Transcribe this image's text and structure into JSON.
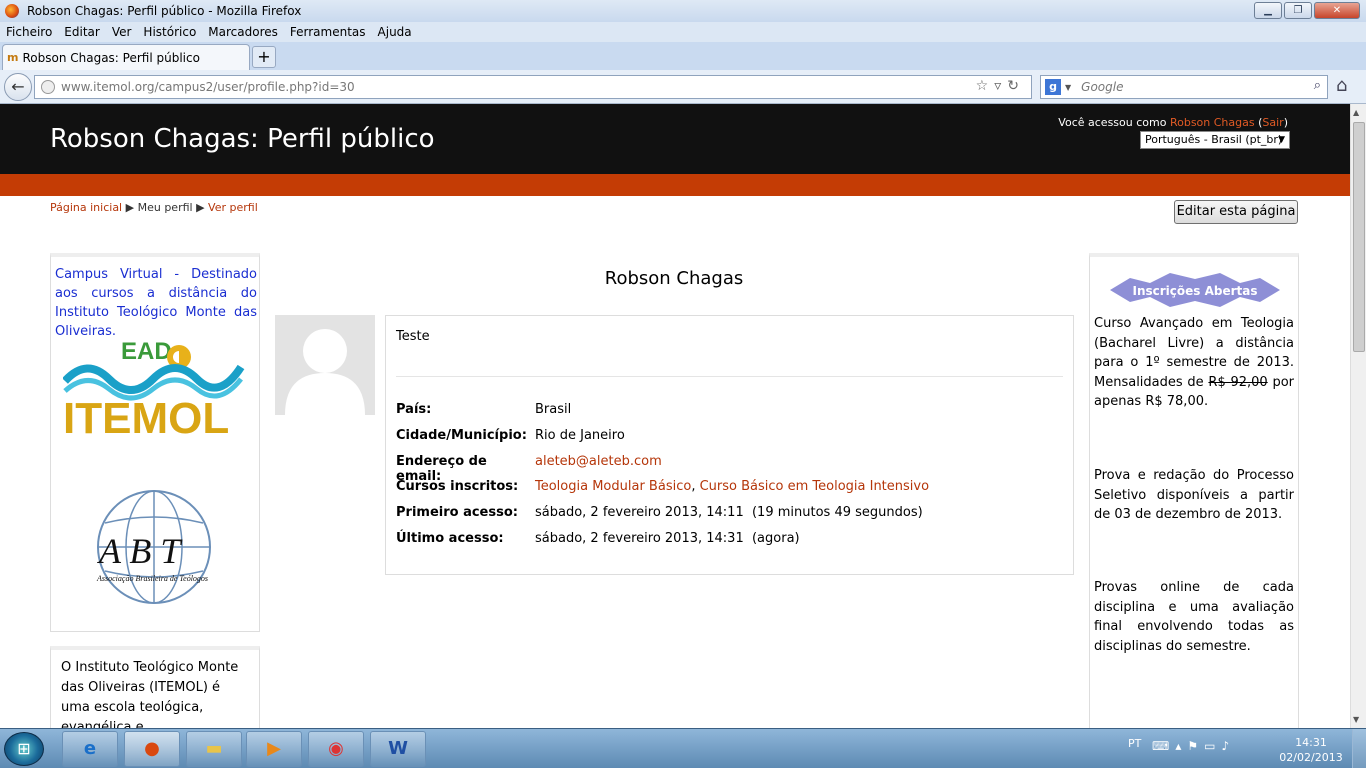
{
  "window": {
    "title": "Robson Chagas: Perfil público - Mozilla Firefox"
  },
  "menu": [
    "Ficheiro",
    "Editar",
    "Ver",
    "Histórico",
    "Marcadores",
    "Ferramentas",
    "Ajuda"
  ],
  "tab": {
    "label": "Robson Chagas: Perfil público",
    "new_tab": "+"
  },
  "nav": {
    "url": "www.itemol.org/campus2/user/profile.php?id=30",
    "search_placeholder": "Google"
  },
  "header": {
    "title": "Robson Chagas: Perfil público",
    "login_prefix": "Você acessou como ",
    "login_user": "Robson Chagas",
    "login_open": " (",
    "logout": "Sair",
    "login_close": ")",
    "language": "Português - Brasil (pt_br)"
  },
  "breadcrumb": {
    "home": "Página inicial",
    "sep": "▶",
    "my_profile": "Meu perfil",
    "view_profile": "Ver perfil"
  },
  "edit_button": "Editar esta página",
  "left": {
    "campus_text": "Campus Virtual - Destinado aos cursos a distância do Instituto Teológico Monte das Oliveiras.",
    "logo1_top": "EAD",
    "logo1_main": "ITEMOL",
    "logo2_main": "A B T",
    "logo2_sub": "Associação Brasileira de Teólogos",
    "about_text": "O Instituto Teológico Monte das Oliveiras (ITEMOL) é uma escola teológica, evangélica e interdenominacional"
  },
  "profile": {
    "name": "Robson Chagas",
    "description": "Teste",
    "fields": [
      {
        "key": "País:",
        "value": "Brasil"
      },
      {
        "key": "Cidade/Município:",
        "value": "Rio de Janeiro"
      },
      {
        "key": "Endereço de email:",
        "value": "aleteb@aleteb.com"
      },
      {
        "key": "Cursos inscritos:",
        "value1": "Teologia Modular Básico",
        "sep": ", ",
        "value2": "Curso Básico em Teologia Intensivo"
      },
      {
        "key": "Primeiro acesso:",
        "value": "sábado, 2 fevereiro 2013, 14:11  (19 minutos 49 segundos)"
      },
      {
        "key": "Último acesso:",
        "value": "sábado, 2 fevereiro 2013, 14:31  (agora)"
      }
    ]
  },
  "right": {
    "badge": "Inscrições Abertas",
    "p1_a": "Curso Avançado em Teologia (Bacharel Livre) a distância para o 1º semestre de 2013. Mensalidades de ",
    "p1_old_price": "R$ 92,00",
    "p1_b": " por apenas R$ 78,00.",
    "p2": "Prova e redação do Processo Seletivo disponíveis a partir de 03 de dezembro de 2013.",
    "p3": "Provas online de cada disciplina e uma avaliação final envolvendo todas as disciplinas do semestre."
  },
  "taskbar": {
    "lang": "PT",
    "time": "14:31",
    "date": "02/02/2013"
  }
}
